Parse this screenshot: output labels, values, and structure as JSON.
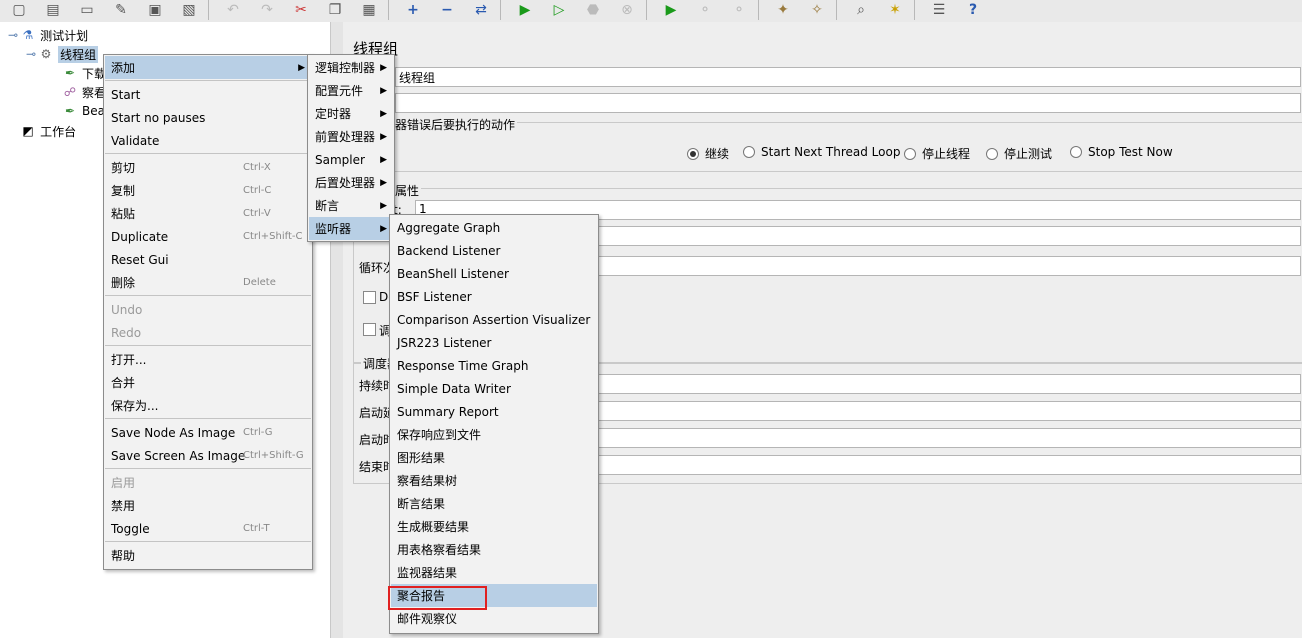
{
  "tree": {
    "test_plan": "测试计划",
    "thread_group": "线程组",
    "child1": "下载",
    "child2": "察看",
    "child3": "Bea",
    "workbench": "工作台"
  },
  "panel": {
    "title": "线程组",
    "name_value": "线程组",
    "error_action_title": "器错误后要执行的动作",
    "radios": [
      "继续",
      "Start Next Thread Loop",
      "停止线程",
      "停止测试",
      "Stop Test Now"
    ],
    "props_title": "属性",
    "threads_label_frag": "t:",
    "threads_value": "1",
    "loop_label_frag": "循环次",
    "check1_label_frag": "De",
    "check2_label_frag": "调",
    "scheduler_title": "调度器",
    "duration_label": "持续时",
    "start_delay_label": "启动延",
    "start_time_label": "启动时",
    "end_time_label": "结束时"
  },
  "context_menu": {
    "add": "添加",
    "start": "Start",
    "start_no_pauses": "Start no pauses",
    "validate": "Validate",
    "cut": "剪切",
    "cut_sc": "Ctrl-X",
    "copy": "复制",
    "copy_sc": "Ctrl-C",
    "paste": "粘贴",
    "paste_sc": "Ctrl-V",
    "duplicate": "Duplicate",
    "duplicate_sc": "Ctrl+Shift-C",
    "reset_gui": "Reset Gui",
    "delete": "删除",
    "delete_sc": "Delete",
    "undo": "Undo",
    "redo": "Redo",
    "open": "打开...",
    "merge": "合并",
    "save_as": "保存为...",
    "save_node_img": "Save Node As Image",
    "save_node_img_sc": "Ctrl-G",
    "save_screen_img": "Save Screen As Image",
    "save_screen_img_sc": "Ctrl+Shift-G",
    "enable": "启用",
    "disable": "禁用",
    "toggle": "Toggle",
    "toggle_sc": "Ctrl-T",
    "help": "帮助"
  },
  "add_submenu": {
    "logic_controller": "逻辑控制器",
    "config_element": "配置元件",
    "timer": "定时器",
    "pre_processor": "前置处理器",
    "sampler": "Sampler",
    "post_processor": "后置处理器",
    "assertion": "断言",
    "listener": "监听器"
  },
  "listener_submenu": [
    "Aggregate Graph",
    "Backend Listener",
    "BeanShell Listener",
    "BSF Listener",
    "Comparison Assertion Visualizer",
    "JSR223 Listener",
    "Response Time Graph",
    "Simple Data Writer",
    "Summary Report",
    "保存响应到文件",
    "图形结果",
    "察看结果树",
    "断言结果",
    "生成概要结果",
    "用表格察看结果",
    "监视器结果",
    "聚合报告",
    "邮件观察仪"
  ],
  "colors": {
    "highlight": "#b8cfe5",
    "red_box": "#e02020"
  }
}
